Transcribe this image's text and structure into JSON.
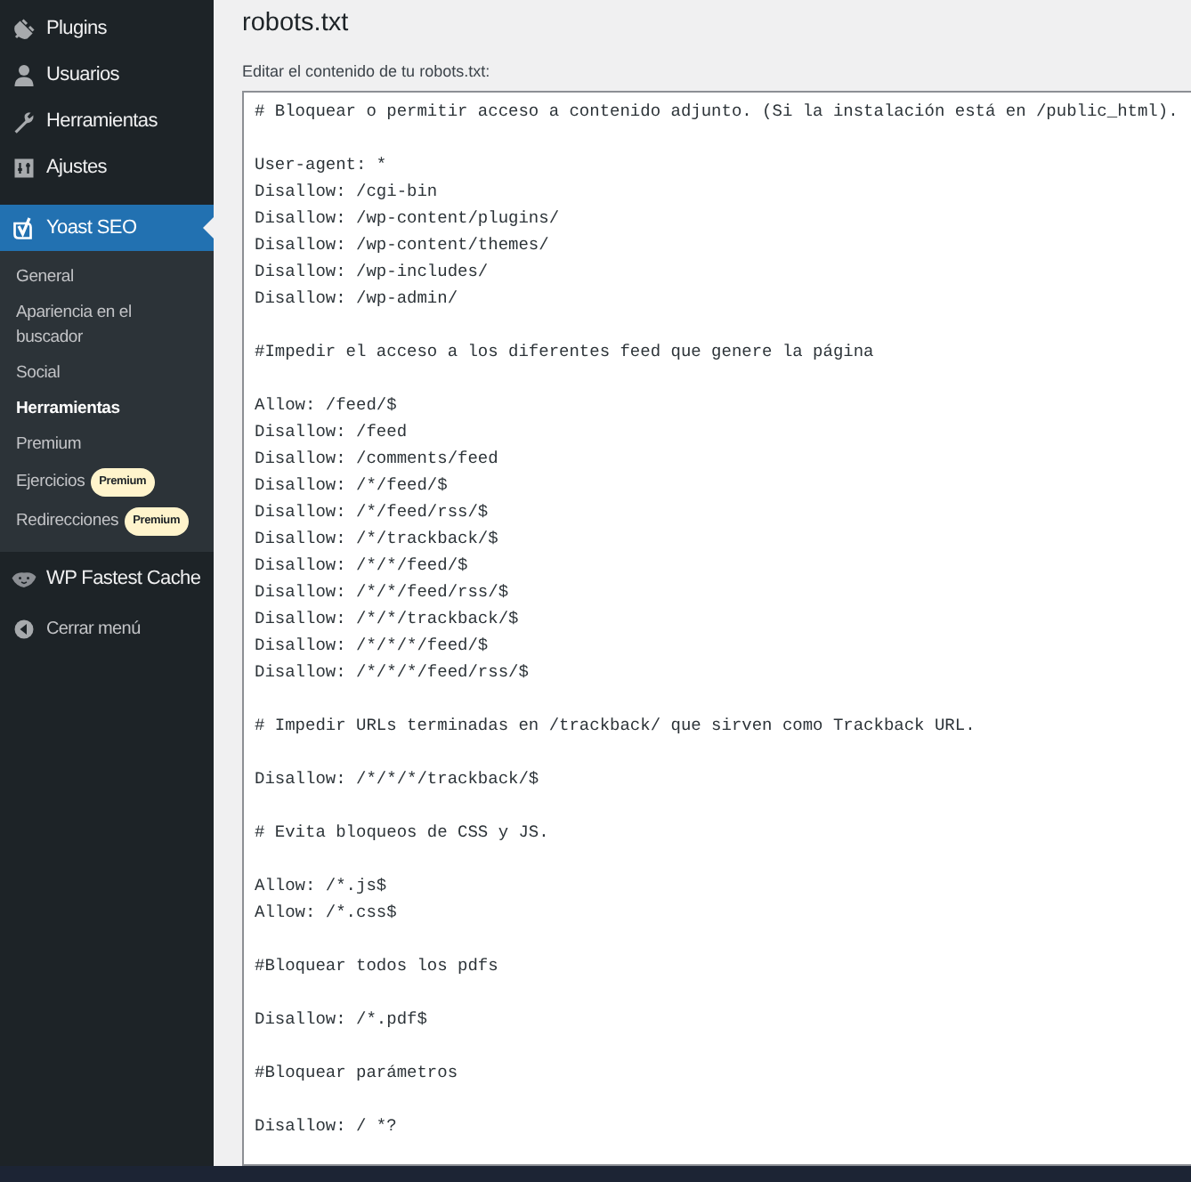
{
  "sidebar": {
    "items": [
      {
        "label": "Plugins",
        "selected": false
      },
      {
        "label": "Usuarios",
        "selected": false
      },
      {
        "label": "Herramientas",
        "selected": false
      },
      {
        "label": "Ajustes",
        "selected": false
      },
      {
        "label": "Yoast SEO",
        "selected": true,
        "submenu": [
          {
            "label": "General",
            "selected": false
          },
          {
            "label": "Apariencia en el buscador",
            "selected": false
          },
          {
            "label": "Social",
            "selected": false
          },
          {
            "label": "Herramientas",
            "selected": true
          },
          {
            "label": "Premium",
            "selected": false
          },
          {
            "label": "Ejercicios",
            "selected": false,
            "badge": "Premium"
          },
          {
            "label": "Redirecciones",
            "selected": false,
            "badge": "Premium"
          }
        ]
      },
      {
        "label": "WP Fastest Cache",
        "selected": false
      }
    ],
    "collapse": "Cerrar menú"
  },
  "page": {
    "title": "robots.txt",
    "editor_label": "Editar el contenido de tu robots.txt:",
    "editor_blocks": [
      [
        "# Bloquear o permitir acceso a contenido adjunto. (Si la instalación está en /public_html)."
      ],
      [
        "User-agent: *",
        "Disallow: /cgi-bin",
        "Disallow: /wp-content/plugins/",
        "Disallow: /wp-content/themes/",
        "Disallow: /wp-includes/",
        "Disallow: /wp-admin/"
      ],
      [
        "#Impedir el acceso a los diferentes feed que genere la página"
      ],
      [
        "Allow: /feed/$",
        "Disallow: /feed",
        "Disallow: /comments/feed",
        "Disallow: /*/feed/$",
        "Disallow: /*/feed/rss/$",
        "Disallow: /*/trackback/$",
        "Disallow: /*/*/feed/$",
        "Disallow: /*/*/feed/rss/$",
        "Disallow: /*/*/trackback/$",
        "Disallow: /*/*/*/feed/$",
        "Disallow: /*/*/*/feed/rss/$"
      ],
      [
        "# Impedir URLs terminadas en /trackback/ que sirven como Trackback URL."
      ],
      [
        "Disallow: /*/*/*/trackback/$"
      ],
      [
        "# Evita bloqueos de CSS y JS."
      ],
      [
        "Allow: /*.js$",
        "Allow: /*.css$"
      ],
      [
        "#Bloquear todos los pdfs"
      ],
      [
        "Disallow: /*.pdf$"
      ],
      [
        "#Bloquear parámetros"
      ],
      [
        "Disallow: / *?"
      ]
    ]
  }
}
